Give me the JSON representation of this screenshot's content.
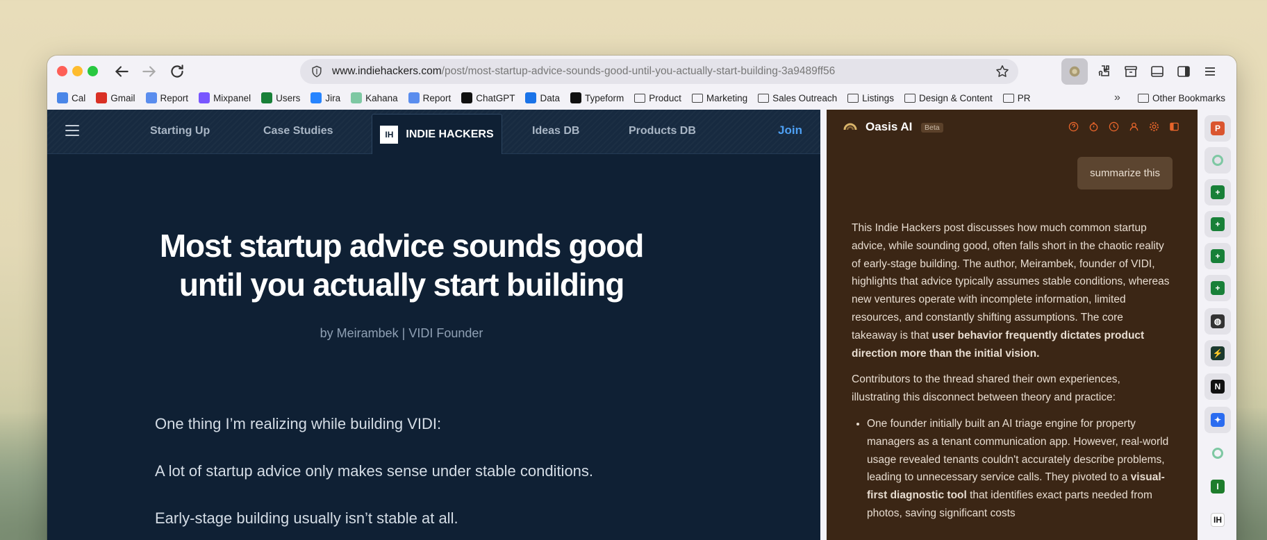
{
  "browser": {
    "url_host": "www.indiehackers.com",
    "url_path": "/post/most-startup-advice-sounds-good-until-you-actually-start-building-3a9489ff56"
  },
  "bookmarks": [
    {
      "label": "Cal",
      "icon": "calendar-icon",
      "color": "#4a86e8"
    },
    {
      "label": "Gmail",
      "icon": "gmail-icon",
      "color": "#d93025"
    },
    {
      "label": "Report",
      "icon": "report-icon",
      "color": "#5a8dee"
    },
    {
      "label": "Mixpanel",
      "icon": "mixpanel-icon",
      "color": "#7856ff"
    },
    {
      "label": "Users",
      "icon": "sheets-icon",
      "color": "#188038"
    },
    {
      "label": "Jira",
      "icon": "jira-icon",
      "color": "#2684ff"
    },
    {
      "label": "Kahana",
      "icon": "kahana-icon",
      "color": "#7ec8a3"
    },
    {
      "label": "Report",
      "icon": "report-icon",
      "color": "#5a8dee"
    },
    {
      "label": "ChatGPT",
      "icon": "chatgpt-icon",
      "color": "#111111"
    },
    {
      "label": "Data",
      "icon": "data-icon",
      "color": "#1a73e8"
    },
    {
      "label": "Typeform",
      "icon": "typeform-icon",
      "color": "#111111"
    },
    {
      "label": "Product",
      "icon": "folder-icon"
    },
    {
      "label": "Marketing",
      "icon": "folder-icon"
    },
    {
      "label": "Sales Outreach",
      "icon": "folder-icon"
    },
    {
      "label": "Listings",
      "icon": "folder-icon"
    },
    {
      "label": "Design & Content",
      "icon": "folder-icon"
    },
    {
      "label": "PR",
      "icon": "folder-icon"
    }
  ],
  "other_bookmarks": "Other Bookmarks",
  "site_nav": {
    "links": [
      "Starting Up",
      "Case Studies",
      "Ideas DB",
      "Products DB"
    ],
    "brand_logo": "IH",
    "brand": "INDIE HACKERS",
    "join": "Join"
  },
  "article": {
    "title": "Most startup advice sounds good until you actually start building",
    "byline": "by Meirambek | VIDI Founder",
    "paragraphs": [
      "One thing I’m realizing while building VIDI:",
      "A lot of startup advice only makes sense under stable conditions.",
      "Early-stage building usually isn’t stable at all."
    ]
  },
  "assistant": {
    "name": "Oasis AI",
    "badge": "Beta",
    "user_message": "summarize this",
    "reply_p1_start": "This Indie Hackers post discusses how much common startup advice, while sounding good, often falls short in the chaotic reality of early-stage building. The author, Meirambek, founder of VIDI, highlights that advice typically assumes stable conditions, whereas new ventures operate with incomplete information, limited resources, and constantly shifting assumptions. The core takeaway is that ",
    "reply_p1_bold": "user behavior frequently dictates product direction more than the initial vision.",
    "reply_p2": "Contributors to the thread shared their own experiences, illustrating this disconnect between theory and practice:",
    "bullet1_start": "One founder initially built an AI triage engine for property managers as a tenant communication app. However, real-world usage revealed tenants couldn't accurately describe problems, leading to unnecessary service calls. They pivoted to a ",
    "bullet1_bold": "visual-first diagnostic tool",
    "bullet1_end": " that identifies exact parts needed from photos, saving significant costs",
    "accent_color": "#e8652b"
  },
  "rail": [
    {
      "name": "product-hunt-icon",
      "color": "#da552f",
      "glyph": "P"
    },
    {
      "name": "kahana-icon",
      "color": "#7ec8a3",
      "glyph": ""
    },
    {
      "name": "sheets-icon",
      "color": "#188038",
      "glyph": "+"
    },
    {
      "name": "sheets-icon",
      "color": "#188038",
      "glyph": "+"
    },
    {
      "name": "sheets-icon",
      "color": "#188038",
      "glyph": "+"
    },
    {
      "name": "sheets-icon",
      "color": "#188038",
      "glyph": "+"
    },
    {
      "name": "globe-icon",
      "color": "#333333",
      "glyph": "◍"
    },
    {
      "name": "activity-icon",
      "color": "#1b3a2e",
      "glyph": "⚡"
    },
    {
      "name": "notion-icon",
      "color": "#111111",
      "glyph": "N"
    },
    {
      "name": "plugin-icon",
      "color": "#2b6cf0",
      "glyph": "✦"
    },
    {
      "name": "kahana-icon",
      "color": "#7ec8a3",
      "glyph": ""
    },
    {
      "name": "green-app-icon",
      "color": "#1e7d2c",
      "glyph": "I"
    },
    {
      "name": "indiehackers-icon",
      "color": "#ffffff",
      "glyph": "IH"
    }
  ]
}
